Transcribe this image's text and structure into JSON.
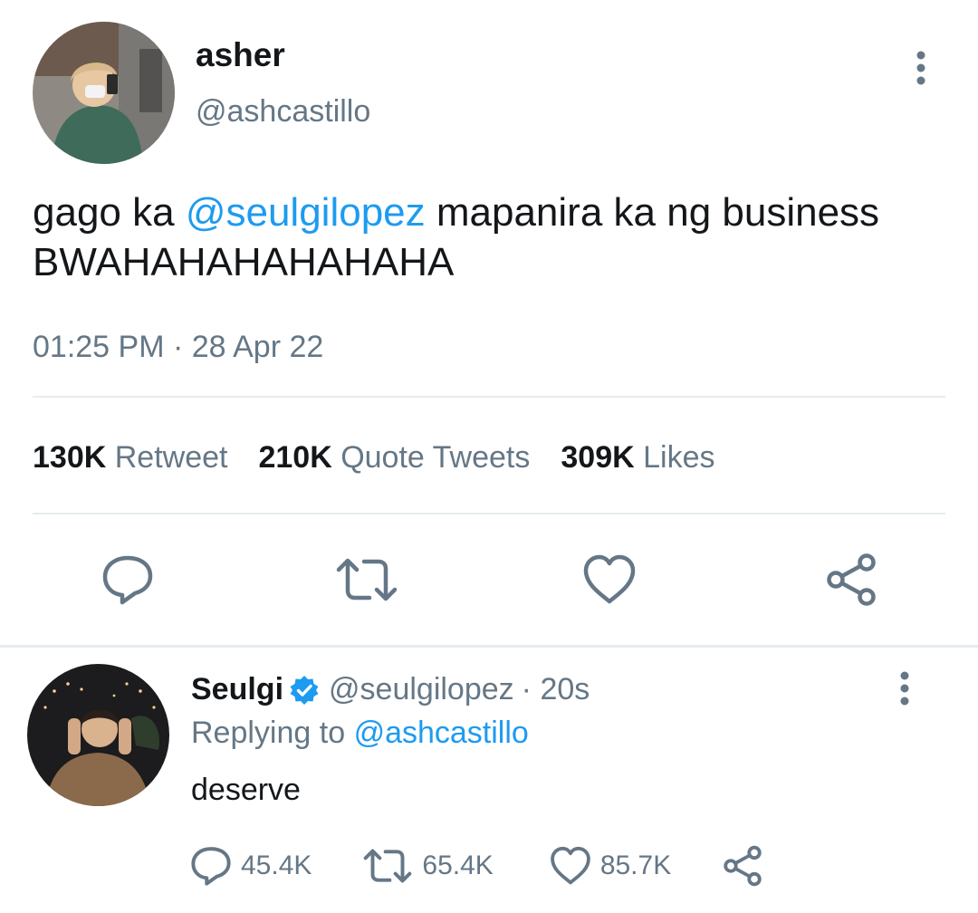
{
  "colors": {
    "text": "#14171a",
    "muted": "#657786",
    "link": "#1d9bf0",
    "verified": "#1d9bf0",
    "divider": "#e6ecf0"
  },
  "main_tweet": {
    "author": {
      "display_name": "asher",
      "handle": "@ashcastillo"
    },
    "text": {
      "prefix": "gago ka ",
      "mention": "@seulgilopez",
      "suffix": " mapanira ka ng business BWAHAHAHAHAHAHA"
    },
    "timestamp": "01:25 PM · 28 Apr 22",
    "stats": [
      {
        "count": "130K",
        "label": "Retweet"
      },
      {
        "count": "210K",
        "label": "Quote Tweets"
      },
      {
        "count": "309K",
        "label": "Likes"
      }
    ],
    "actions": [
      "reply-icon",
      "retweet-icon",
      "like-icon",
      "share-icon"
    ]
  },
  "reply_tweet": {
    "author": {
      "display_name": "Seulgi",
      "handle": "@seulgilopez",
      "verified": true
    },
    "time_ago": "· 20s",
    "replying_prefix": "Replying to",
    "replying_to": "@ashcastillo",
    "text": "deserve",
    "counts": {
      "replies": "45.4K",
      "retweets": "65.4K",
      "likes": "85.7K"
    }
  }
}
